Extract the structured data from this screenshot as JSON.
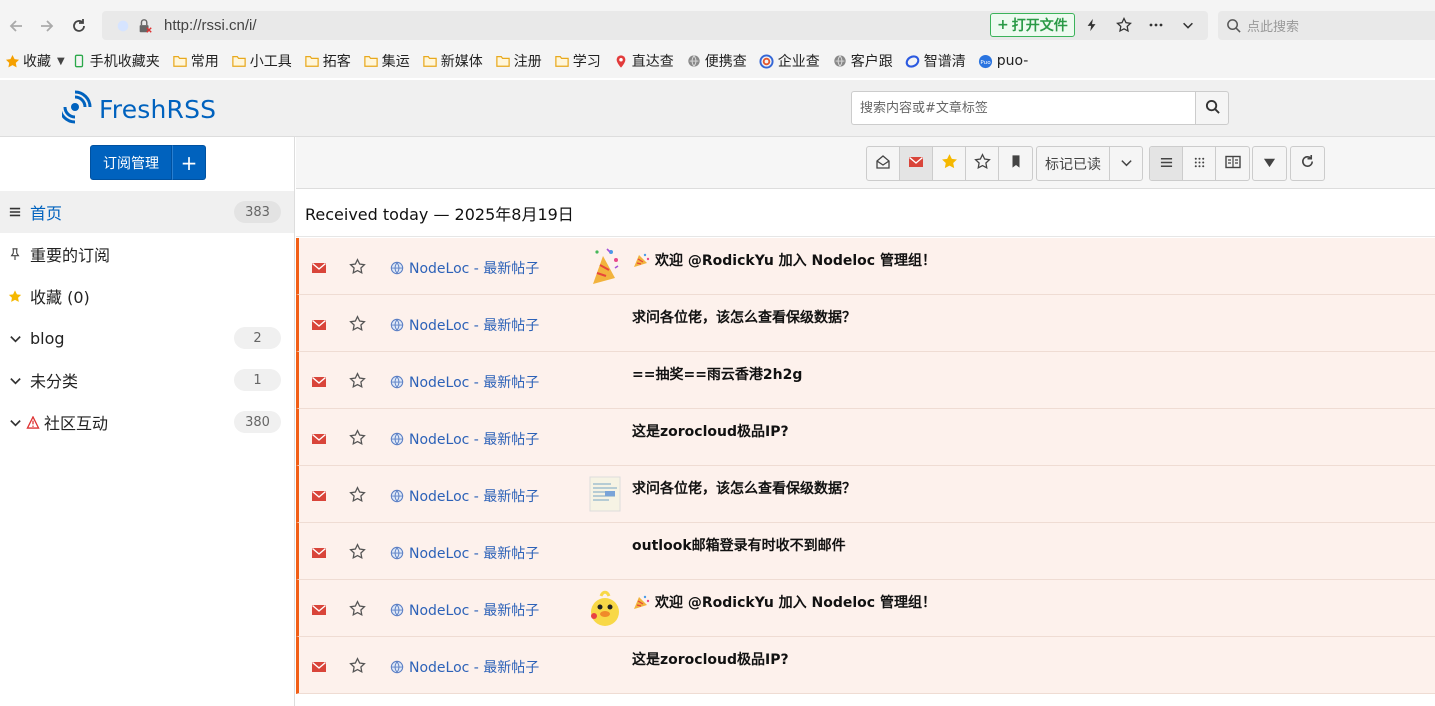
{
  "browser": {
    "url": "http://rssi.cn/i/",
    "open_file_label": "打开文件",
    "search_placeholder": "点此搜索"
  },
  "bookmarks": [
    {
      "label": "收藏",
      "icon": "star-icon"
    },
    {
      "label": "手机收藏夹",
      "icon": "phone-icon"
    },
    {
      "label": "常用",
      "icon": "folder-icon"
    },
    {
      "label": "小工具",
      "icon": "folder-icon"
    },
    {
      "label": "拓客",
      "icon": "folder-icon"
    },
    {
      "label": "集运",
      "icon": "folder-icon"
    },
    {
      "label": "新媒体",
      "icon": "folder-icon"
    },
    {
      "label": "注册",
      "icon": "folder-icon"
    },
    {
      "label": "学习",
      "icon": "folder-icon"
    },
    {
      "label": "直达查",
      "icon": "pin-icon"
    },
    {
      "label": "便携查",
      "icon": "globe-icon"
    },
    {
      "label": "企业查",
      "icon": "swirl-icon"
    },
    {
      "label": "客户跟",
      "icon": "globe-icon"
    },
    {
      "label": "智谱清",
      "icon": "ring-icon"
    },
    {
      "label": "puo-",
      "icon": "puo-icon"
    }
  ],
  "app": {
    "logo_text": "FreshRSS",
    "search_placeholder": "搜索内容或#文章标签"
  },
  "sidebar": {
    "subscriptions_label": "订阅管理",
    "add_label": "+",
    "categories": [
      {
        "label": "首页",
        "count": "383",
        "icon": "menu-icon",
        "active": true
      },
      {
        "label": "重要的订阅",
        "count": "",
        "icon": "pin-icon"
      },
      {
        "label": "收藏 (0)",
        "count": "",
        "icon": "star-icon"
      },
      {
        "label": "blog",
        "count": "2",
        "icon": "chevron-down-icon"
      },
      {
        "label": "未分类",
        "count": "1",
        "icon": "chevron-down-icon"
      },
      {
        "label": "社区互动",
        "count": "380",
        "icon": "chevron-down-icon",
        "warning": true
      }
    ]
  },
  "toolbar": {
    "mark_read_label": "标记已读"
  },
  "main": {
    "day_title": "Received today — 2025年8月19日",
    "articles": [
      {
        "feed": "NodeLoc - 最新帖子",
        "title": "欢迎 @RodickYu 加入 Nodeloc 管理组！",
        "thumb": "party",
        "emoji": true
      },
      {
        "feed": "NodeLoc - 最新帖子",
        "title": "求问各位佬，该怎么查看保级数据？",
        "thumb": "",
        "emoji": false
      },
      {
        "feed": "NodeLoc - 最新帖子",
        "title": "==抽奖==雨云香港2h2g",
        "thumb": "",
        "emoji": false
      },
      {
        "feed": "NodeLoc - 最新帖子",
        "title": "这是zorocloud极品IP?",
        "thumb": "",
        "emoji": false
      },
      {
        "feed": "NodeLoc - 最新帖子",
        "title": "求问各位佬，该怎么查看保级数据？",
        "thumb": "doc",
        "emoji": false
      },
      {
        "feed": "NodeLoc - 最新帖子",
        "title": "outlook邮箱登录有时收不到邮件",
        "thumb": "",
        "emoji": false
      },
      {
        "feed": "NodeLoc - 最新帖子",
        "title": "欢迎 @RodickYu 加入 Nodeloc 管理组！",
        "thumb": "duck",
        "emoji": true
      },
      {
        "feed": "NodeLoc - 最新帖子",
        "title": "这是zorocloud极品IP?",
        "thumb": "",
        "emoji": false
      }
    ]
  },
  "colors": {
    "accent": "#0062be",
    "unread_border": "#f25e15",
    "unread_bg": "#fdf1ec",
    "mail_red": "#d9453a",
    "star_gold": "#f5b800"
  }
}
